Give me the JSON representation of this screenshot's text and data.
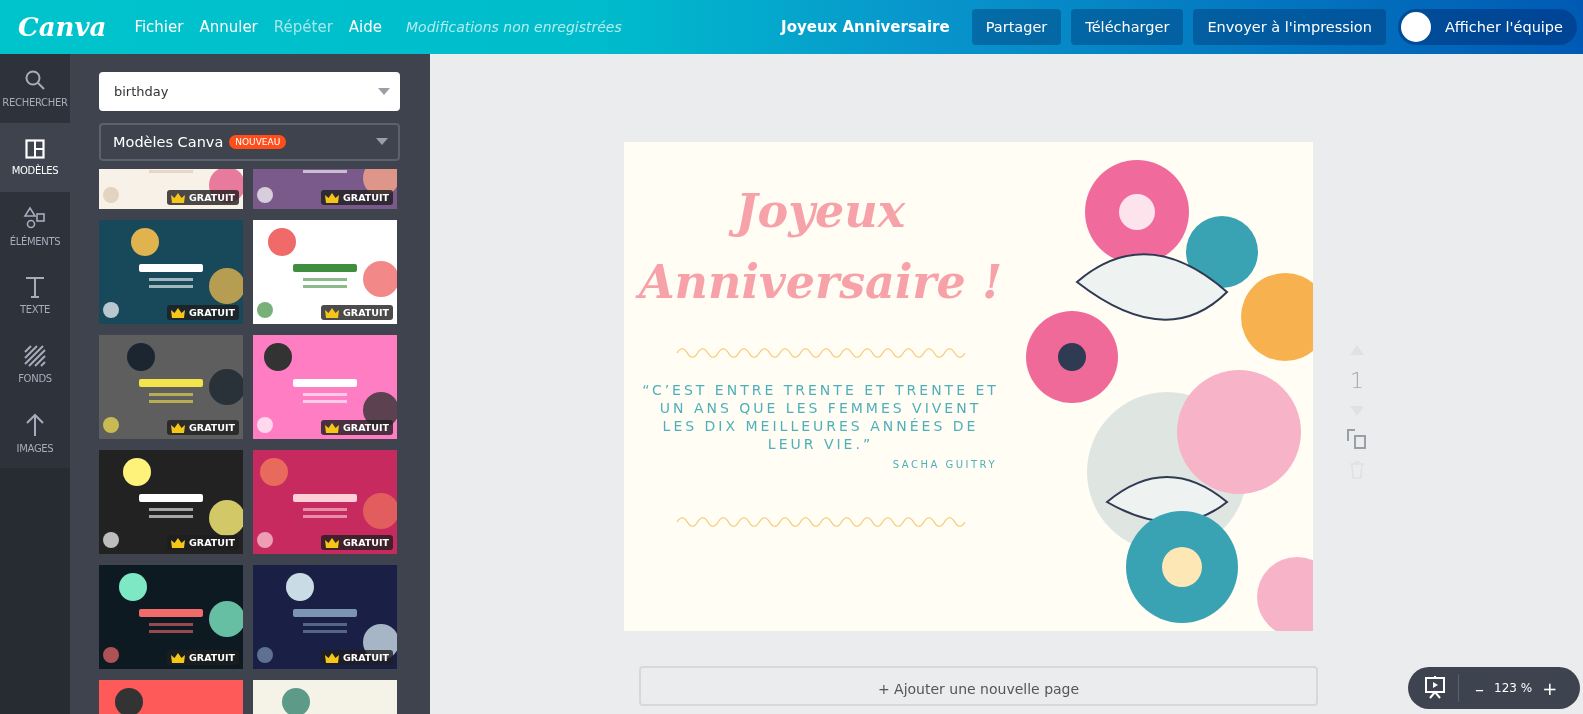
{
  "topbar": {
    "logo": "Canva",
    "menu": [
      {
        "label": "Fichier",
        "disabled": false
      },
      {
        "label": "Annuler",
        "disabled": false
      },
      {
        "label": "Répéter",
        "disabled": true
      },
      {
        "label": "Aide",
        "disabled": false
      }
    ],
    "status": "Modifications non enregistrées",
    "document_title": "Joyeux Anniversaire",
    "buttons": [
      "Partager",
      "Télécharger",
      "Envoyer à l'impression"
    ],
    "team_toggle": {
      "label": "Afficher l'équipe",
      "on": false
    }
  },
  "sidebar": {
    "items": [
      {
        "kind": "search",
        "label": "RECHERCHER",
        "selected": false
      },
      {
        "kind": "templates",
        "label": "MODÈLES",
        "selected": true
      },
      {
        "kind": "elements",
        "label": "ÉLÉMENTS",
        "selected": false
      },
      {
        "kind": "text",
        "label": "TEXTE",
        "selected": false
      },
      {
        "kind": "backgrounds",
        "label": "FONDS",
        "selected": false
      },
      {
        "kind": "uploads",
        "label": "IMAGES",
        "selected": false
      }
    ]
  },
  "panel": {
    "search": {
      "value": "birthday"
    },
    "source": {
      "label": "Modèles Canva",
      "badge": "NOUVEAU"
    },
    "templates": [
      {
        "kind": "picture",
        "badge": "GRATUIT"
      },
      {
        "kind": "picture",
        "badge": "GRATUIT"
      },
      {
        "kind": "picture",
        "badge": "GRATUIT"
      },
      {
        "kind": "picture",
        "badge": "GRATUIT"
      },
      {
        "kind": "picture",
        "badge": "GRATUIT"
      },
      {
        "kind": "picture",
        "badge": "GRATUIT"
      },
      {
        "kind": "picture",
        "badge": "GRATUIT"
      },
      {
        "kind": "picture",
        "badge": "GRATUIT"
      },
      {
        "kind": "picture",
        "badge": "GRATUIT"
      },
      {
        "kind": "picture",
        "badge": "GRATUIT"
      },
      {
        "kind": "picture"
      },
      {
        "kind": "picture"
      }
    ]
  },
  "canvas": {
    "card": {
      "title": "Joyeux Anniversaire !",
      "quote": "“C’EST ENTRE TRENTE ET TRENTE ET UN ANS QUE LES FEMMES VIVENT LES DIX MEILLEURES ANNÉES DE LEUR VIE.”",
      "author": "SACHA GUITRY",
      "illustration": {
        "kind": "picture"
      }
    },
    "page_number": "1",
    "tools": [
      {
        "kind": "move-up",
        "disabled": true
      },
      {
        "kind": "move-down",
        "disabled": true
      },
      {
        "kind": "duplicate",
        "disabled": false
      },
      {
        "kind": "delete",
        "disabled": true
      }
    ],
    "add_page": "+ Ajouter une nouvelle page"
  },
  "zoom": {
    "minus": "–",
    "value": "123 %",
    "plus": "+"
  }
}
